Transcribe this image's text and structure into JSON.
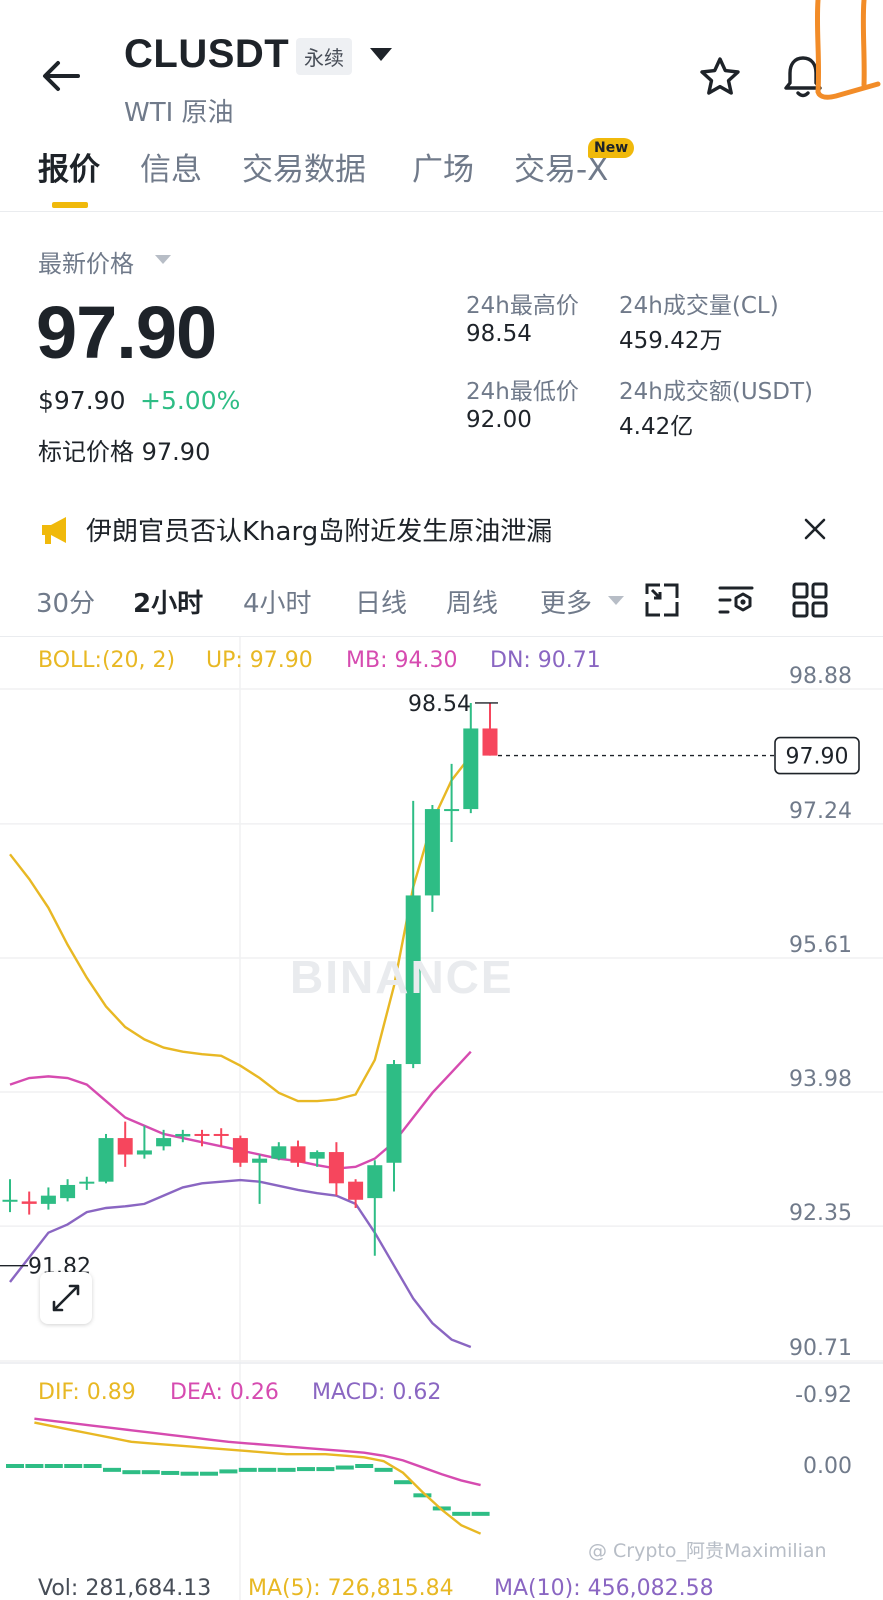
{
  "header": {
    "symbol": "CLUSDT",
    "contract_type": "永续",
    "subtitle": "WTI 原油"
  },
  "tabs": [
    {
      "label": "报价",
      "active": true
    },
    {
      "label": "信息",
      "active": false
    },
    {
      "label": "交易数据",
      "active": false
    },
    {
      "label": "广场",
      "active": false
    },
    {
      "label": "交易-X",
      "active": false,
      "badge": "New"
    }
  ],
  "price": {
    "label": "最新价格",
    "last": "97.90",
    "usd": "$97.90",
    "change": "+5.00%",
    "mark_label": "标记价格",
    "mark_value": "97.90"
  },
  "stats": {
    "high_label": "24h最高价",
    "high_value": "98.54",
    "low_label": "24h最低价",
    "low_value": "92.00",
    "vol_label": "24h成交量(CL)",
    "vol_value": "459.42万",
    "amt_label": "24h成交额(USDT)",
    "amt_value": "4.42亿"
  },
  "announcement": "伊朗官员否认Kharg岛附近发生原油泄漏",
  "intervals": [
    {
      "label": "30分",
      "active": false
    },
    {
      "label": "2小时",
      "active": true
    },
    {
      "label": "4小时",
      "active": false
    },
    {
      "label": "日线",
      "active": false
    },
    {
      "label": "周线",
      "active": false
    },
    {
      "label": "更多",
      "active": false
    }
  ],
  "indicators": {
    "boll_name": "BOLL:(20, 2)",
    "boll_up": "UP: 97.90",
    "boll_mb": "MB: 94.30",
    "boll_dn": "DN: 90.71",
    "dif": "DIF: 0.89",
    "dea": "DEA: 0.26",
    "macd": "MACD: 0.62",
    "vol": "Vol: 281,684.13",
    "ma5": "MA(5): 726,815.84",
    "ma10": "MA(10): 456,082.58"
  },
  "watermark": "BINANCE",
  "footer_watermark": "@ Crypto_阿贵Maximilian",
  "colors": {
    "up": "#2ebd85",
    "down": "#f6465d",
    "accent": "#f0b90b",
    "boll_up": "#e8b824",
    "boll_mb": "#d64bb0",
    "boll_dn": "#8a66c2",
    "text_secondary": "#707a8a"
  },
  "chart_data": {
    "type": "candlestick",
    "price_axis_ticks": [
      "98.88",
      "97.24",
      "95.61",
      "93.98",
      "92.35",
      "90.71"
    ],
    "last_price_tag": "97.90",
    "high_marker": "98.54",
    "low_marker": "91.82",
    "candles": [
      {
        "o": 92.5,
        "h": 92.75,
        "l": 92.35,
        "c": 92.5
      },
      {
        "o": 92.48,
        "h": 92.6,
        "l": 92.32,
        "c": 92.45
      },
      {
        "o": 92.45,
        "h": 92.65,
        "l": 92.38,
        "c": 92.55
      },
      {
        "o": 92.52,
        "h": 92.75,
        "l": 92.48,
        "c": 92.68
      },
      {
        "o": 92.7,
        "h": 92.78,
        "l": 92.62,
        "c": 92.72
      },
      {
        "o": 92.72,
        "h": 93.3,
        "l": 92.7,
        "c": 93.25
      },
      {
        "o": 93.25,
        "h": 93.45,
        "l": 92.9,
        "c": 93.05
      },
      {
        "o": 93.05,
        "h": 93.4,
        "l": 93.0,
        "c": 93.1
      },
      {
        "o": 93.15,
        "h": 93.35,
        "l": 93.1,
        "c": 93.25
      },
      {
        "o": 93.27,
        "h": 93.35,
        "l": 93.2,
        "c": 93.3
      },
      {
        "o": 93.3,
        "h": 93.35,
        "l": 93.15,
        "c": 93.28
      },
      {
        "o": 93.3,
        "h": 93.37,
        "l": 93.15,
        "c": 93.28
      },
      {
        "o": 93.25,
        "h": 93.28,
        "l": 92.9,
        "c": 92.95
      },
      {
        "o": 92.95,
        "h": 93.05,
        "l": 92.45,
        "c": 93.0
      },
      {
        "o": 93.0,
        "h": 93.2,
        "l": 92.98,
        "c": 93.15
      },
      {
        "o": 93.15,
        "h": 93.22,
        "l": 92.9,
        "c": 92.95
      },
      {
        "o": 93.0,
        "h": 93.1,
        "l": 92.9,
        "c": 93.08
      },
      {
        "o": 93.08,
        "h": 93.2,
        "l": 92.55,
        "c": 92.7
      },
      {
        "o": 92.72,
        "h": 92.75,
        "l": 92.4,
        "c": 92.5
      },
      {
        "o": 92.52,
        "h": 92.98,
        "l": 91.82,
        "c": 92.92
      },
      {
        "o": 92.95,
        "h": 94.2,
        "l": 92.6,
        "c": 94.15
      },
      {
        "o": 94.15,
        "h": 97.35,
        "l": 94.1,
        "c": 96.2
      },
      {
        "o": 96.2,
        "h": 97.3,
        "l": 96.0,
        "c": 97.25
      },
      {
        "o": 97.25,
        "h": 97.8,
        "l": 96.85,
        "c": 97.25
      },
      {
        "o": 97.25,
        "h": 98.54,
        "l": 97.2,
        "c": 98.23
      },
      {
        "o": 98.23,
        "h": 98.54,
        "l": 97.9,
        "c": 97.9
      }
    ],
    "boll_up": [
      96.7,
      96.4,
      96.05,
      95.6,
      95.2,
      94.85,
      94.6,
      94.45,
      94.35,
      94.3,
      94.27,
      94.25,
      94.13,
      93.98,
      93.8,
      93.7,
      93.7,
      93.72,
      93.78,
      94.2,
      95.1,
      96.3,
      97.1,
      97.6,
      97.9
    ],
    "boll_mb": [
      93.9,
      93.98,
      94.0,
      93.98,
      93.9,
      93.7,
      93.5,
      93.4,
      93.3,
      93.25,
      93.2,
      93.15,
      93.1,
      93.05,
      93.0,
      92.97,
      92.92,
      92.88,
      92.9,
      93.0,
      93.2,
      93.5,
      93.8,
      94.05,
      94.3
    ],
    "boll_dn": [
      91.5,
      91.8,
      92.1,
      92.2,
      92.35,
      92.4,
      92.42,
      92.45,
      92.55,
      92.65,
      92.7,
      92.72,
      92.74,
      92.72,
      92.67,
      92.62,
      92.58,
      92.55,
      92.45,
      92.1,
      91.7,
      91.3,
      91.0,
      90.8,
      90.71
    ],
    "macd_axis_ticks": [
      "0.00",
      "-0.92"
    ],
    "macd_hist": [
      -0.01,
      -0.01,
      -0.02,
      -0.02,
      0.0,
      0.05,
      0.08,
      0.08,
      0.09,
      0.1,
      0.1,
      0.07,
      0.05,
      0.05,
      0.05,
      0.04,
      0.04,
      0.02,
      -0.01,
      0.05,
      0.21,
      0.38,
      0.55,
      0.62,
      0.62
    ],
    "dif": [
      -0.55,
      -0.5,
      -0.45,
      -0.4,
      -0.35,
      -0.3,
      -0.28,
      -0.26,
      -0.24,
      -0.22,
      -0.2,
      -0.18,
      -0.16,
      -0.14,
      -0.14,
      -0.14,
      -0.12,
      -0.1,
      -0.05,
      0.1,
      0.35,
      0.58,
      0.78,
      0.89
    ],
    "dea": [
      -0.6,
      -0.57,
      -0.54,
      -0.51,
      -0.48,
      -0.45,
      -0.42,
      -0.39,
      -0.36,
      -0.33,
      -0.3,
      -0.28,
      -0.26,
      -0.24,
      -0.22,
      -0.2,
      -0.18,
      -0.16,
      -0.12,
      -0.06,
      0.03,
      0.12,
      0.2,
      0.26
    ]
  }
}
